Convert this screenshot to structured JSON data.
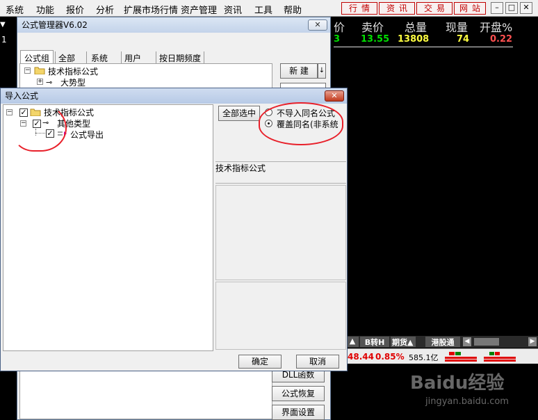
{
  "menubar": {
    "items": [
      "系统",
      "功能",
      "报价",
      "分析",
      "扩展市场行情",
      "资产管理",
      "资讯",
      "工具",
      "帮助"
    ],
    "red_buttons": [
      "行情",
      "资讯",
      "交易",
      "网站"
    ]
  },
  "quote": {
    "headers": [
      "价",
      "卖价",
      "总量",
      "现量",
      "开盘%"
    ],
    "values": [
      "3",
      "13.55",
      "13808",
      "74",
      "0.22"
    ],
    "row_marker": "1",
    "tabs": [
      "B转H",
      "期货",
      "港股通"
    ],
    "tab_arrows": [
      "▲",
      "▲"
    ],
    "status_index": "48.44",
    "status_pct": "0.85%",
    "status_amount": "585.1亿"
  },
  "formula_manager": {
    "title": "公式管理器V6.02",
    "tabs": [
      "公式组",
      "全部",
      "系统",
      "用户",
      "按日期频度"
    ],
    "tree_root": "技术指标公式",
    "tree_child": "大势型",
    "new_button": "新 建",
    "side_buttons": [
      "DLL函数",
      "公式恢复",
      "界面设置"
    ]
  },
  "import_dialog": {
    "title": "导入公式",
    "tree": {
      "root": "技术指标公式",
      "child": "其他类型",
      "leaf": "公式导出"
    },
    "select_all_button": "全部选中",
    "options": [
      "不导入同名公式",
      "覆盖同名(非系统"
    ],
    "selected_option": 1,
    "info_label": "技术指标公式",
    "ok_button": "确定",
    "cancel_button": "取消"
  },
  "colors": {
    "up": "#ff5050",
    "down": "#00e000",
    "accent_red": "#e8202a",
    "title_bar": "#c3d3ea"
  },
  "watermark": {
    "brand": "Baidu经验",
    "url": "jingyan.baidu.com"
  }
}
